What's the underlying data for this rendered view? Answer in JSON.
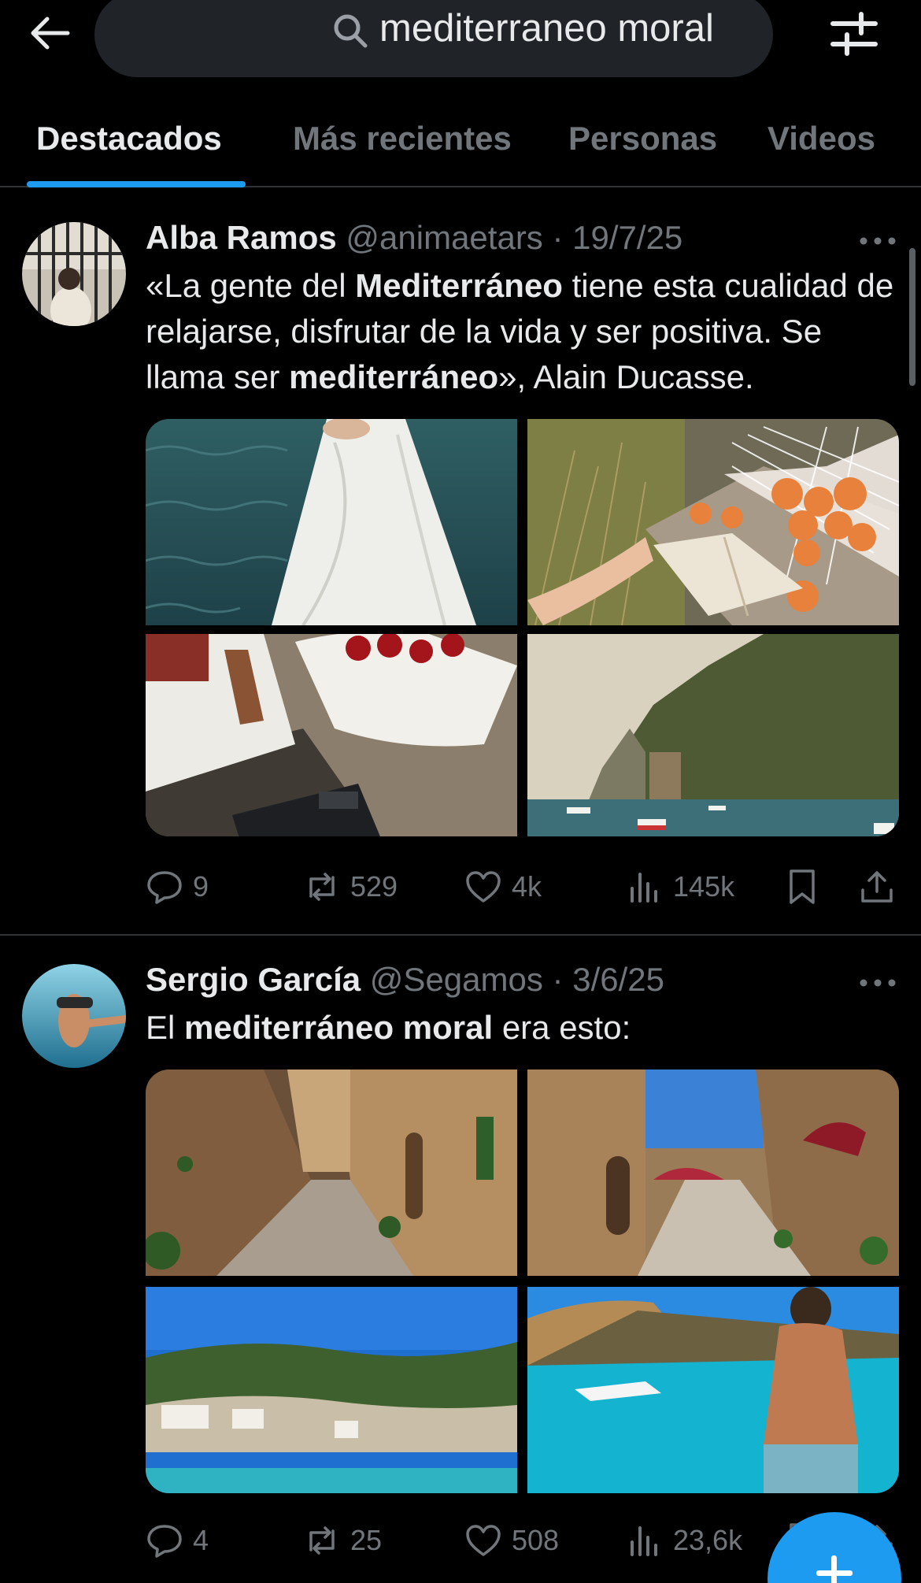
{
  "search": {
    "query": "mediterraneo moral"
  },
  "tabs": [
    {
      "label": "Destacados",
      "active": true
    },
    {
      "label": "Más recientes",
      "active": false
    },
    {
      "label": "Personas",
      "active": false
    },
    {
      "label": "Videos",
      "active": false
    }
  ],
  "colors": {
    "accent": "#1d9bf0",
    "background": "#000000",
    "text": "#e7e9ea",
    "muted": "#71767b",
    "divider": "#2f3336"
  },
  "posts": [
    {
      "author": "Alba Ramos",
      "handle": "@animaetars",
      "separator": "·",
      "date": "19/7/25",
      "text_parts": [
        {
          "text": "«La gente del ",
          "bold": false
        },
        {
          "text": "Mediterráneo",
          "bold": true
        },
        {
          "text": " tiene esta cualidad de relajarse, disfrutar de la vida y ser positiva. Se llama ser ",
          "bold": false
        },
        {
          "text": "mediterráneo",
          "bold": true
        },
        {
          "text": "», Alain Ducasse.",
          "bold": false
        }
      ],
      "media": [
        "sea-white-dress",
        "book-apricots-picnic",
        "cherries-book-camera",
        "coastal-cliffs-boats"
      ],
      "stats": {
        "replies": "9",
        "reposts": "529",
        "likes": "4k",
        "views": "145k"
      }
    },
    {
      "author": "Sergio García",
      "handle": "@Segamos",
      "separator": "·",
      "date": "3/6/25",
      "text_parts": [
        {
          "text": "El ",
          "bold": false
        },
        {
          "text": "mediterráneo moral",
          "bold": true
        },
        {
          "text": " era esto:",
          "bold": false
        }
      ],
      "media": [
        "stone-village-alley",
        "village-street-umbrellas",
        "cove-pine-coast",
        "turquoise-bay-swimmer"
      ],
      "stats": {
        "replies": "4",
        "reposts": "25",
        "likes": "508",
        "views": "23,6k"
      }
    }
  ],
  "icons": {
    "back": "arrow-left-icon",
    "search": "search-icon",
    "filter": "sliders-icon",
    "more": "more-horizontal-icon",
    "reply": "reply-icon",
    "repost": "repost-icon",
    "like": "heart-icon",
    "views": "views-icon",
    "bookmark": "bookmark-icon",
    "share": "share-icon",
    "compose": "plus-icon"
  }
}
